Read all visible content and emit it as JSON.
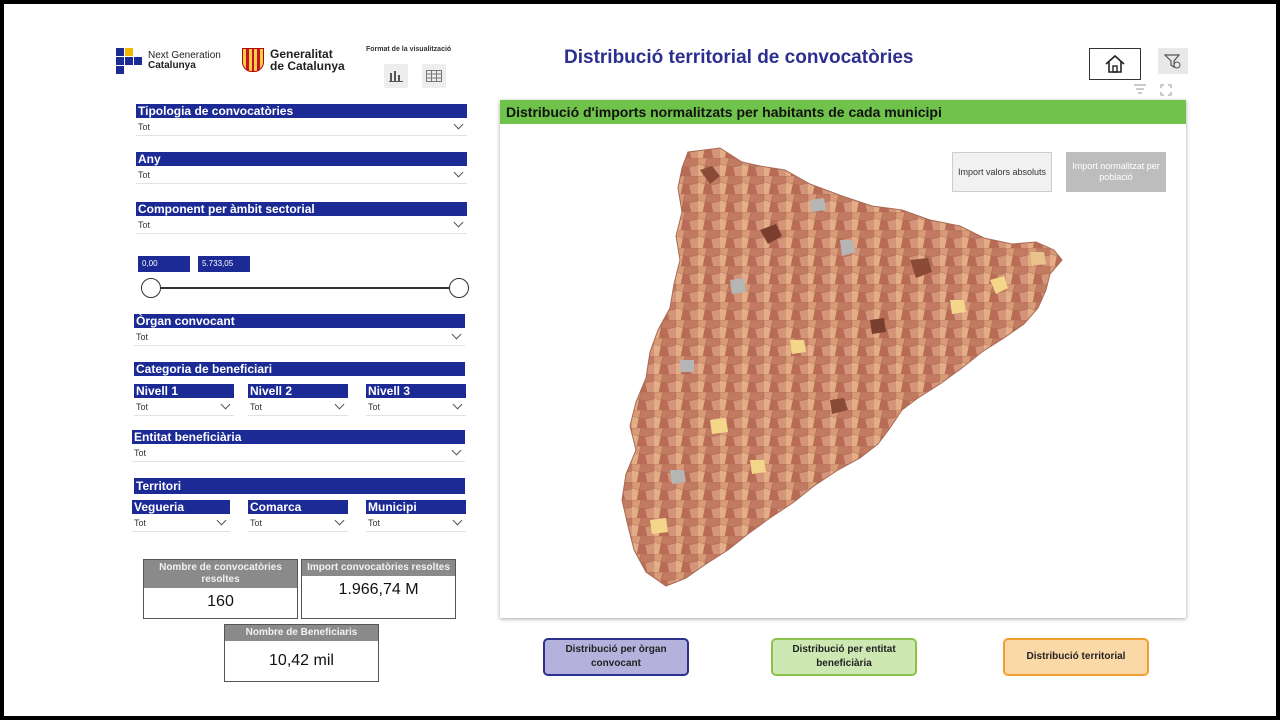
{
  "header": {
    "ngc_logo": [
      "Next Generation",
      "Catalunya"
    ],
    "gen_logo": [
      "Generalitat",
      "de Catalunya"
    ],
    "format_title": "Format de la visualització",
    "title": "Distribució territorial de convocatòries"
  },
  "filters": {
    "tipologia": {
      "label": "Tipologia de convocatòries",
      "value": "Tot"
    },
    "any": {
      "label": "Any",
      "value": "Tot"
    },
    "component": {
      "label": "Component per àmbit sectorial",
      "value": "Tot"
    },
    "range": {
      "min": "0,00",
      "max": "5.733,05"
    },
    "organ": {
      "label": "Òrgan convocant",
      "value": "Tot"
    },
    "categoria": {
      "label": "Categoria de beneficiari",
      "nivell1": {
        "label": "Nivell 1",
        "value": "Tot"
      },
      "nivell2": {
        "label": "Nivell 2",
        "value": "Tot"
      },
      "nivell3": {
        "label": "Nivell 3",
        "value": "Tot"
      }
    },
    "entitat": {
      "label": "Entitat beneficiària",
      "value": "Tot"
    },
    "territori": {
      "label": "Territori",
      "vegueria": {
        "label": "Vegueria",
        "value": "Tot"
      },
      "comarca": {
        "label": "Comarca",
        "value": "Tot"
      },
      "municipi": {
        "label": "Municipi",
        "value": "Tot"
      }
    }
  },
  "cards": {
    "convocatories": {
      "label": "Nombre de convocatòries resoltes",
      "value": "160"
    },
    "import": {
      "label": "Import convocatòries resoltes",
      "value": "1.966,74 M"
    },
    "beneficiaris": {
      "label": "Nombre de Beneficiaris",
      "value": "10,42 mil"
    }
  },
  "map": {
    "title": "Distribució d'imports normalitzats per habitants de cada municipi",
    "toggle_absolute": "Import valors absoluts",
    "toggle_normalized": "Import normalitzat per població"
  },
  "nav": {
    "organ": "Distribució per òrgan convocant",
    "entitat": "Distribució per entitat beneficiària",
    "territorial": "Distribució territorial"
  },
  "colors": {
    "slicer_header": "#1b2a94",
    "title": "#2b2f8f",
    "map_header": "#6fc24a",
    "nav_organ": "#2b2f8f",
    "nav_entitat": "#8bc34a",
    "nav_territorial": "#f0a030"
  }
}
